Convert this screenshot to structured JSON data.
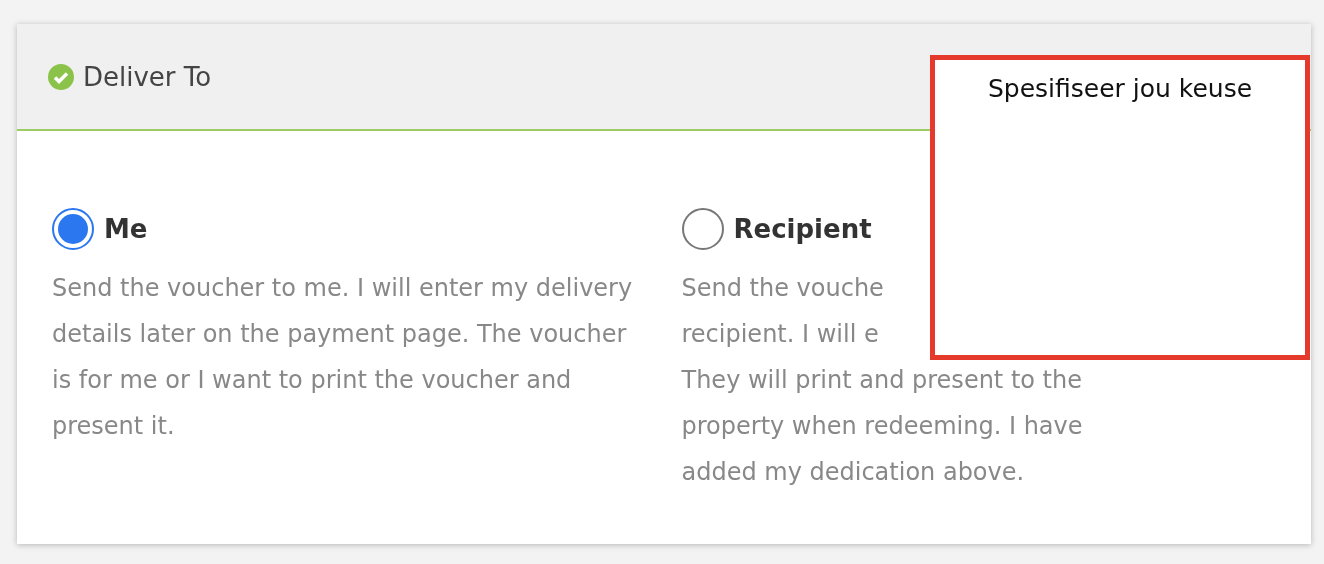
{
  "section": {
    "title": "Deliver To",
    "complete": true
  },
  "options": [
    {
      "label": "Me",
      "selected": true,
      "description": "Send the voucher to me. I will enter my delivery details later on the payment page. The voucher is for me or I want to print the voucher and present it."
    },
    {
      "label": "Recipient",
      "selected": false,
      "description_lines": [
        "Send the vouche",
        "recipient. I will e",
        "They will print and present to the",
        "property when redeeming. I have",
        "added my dedication above."
      ]
    }
  ],
  "callout": {
    "text": "Spesifiseer jou keuse"
  }
}
